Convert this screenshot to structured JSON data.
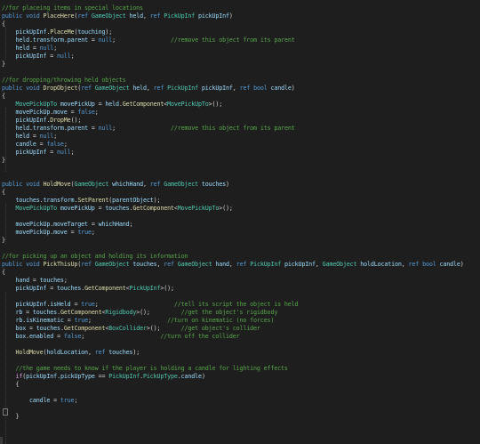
{
  "editor": {
    "lines": [
      [
        [
          "c",
          "//for placeing items in special locations"
        ]
      ],
      [
        [
          "k",
          "public "
        ],
        [
          "k",
          "void "
        ],
        [
          "f",
          "PlaceHere"
        ],
        [
          "p",
          "("
        ],
        [
          "k",
          "ref "
        ],
        [
          "t",
          "GameObject "
        ],
        [
          "v",
          "held"
        ],
        [
          "p",
          ", "
        ],
        [
          "k",
          "ref "
        ],
        [
          "t",
          "PickUpInf "
        ],
        [
          "v",
          "pickUpInf"
        ],
        [
          "p",
          ")"
        ]
      ],
      [
        [
          "p",
          "{"
        ]
      ],
      [
        [
          "p",
          "    "
        ],
        [
          "v",
          "pickUpInf"
        ],
        [
          "p",
          "."
        ],
        [
          "f",
          "PlaceMe"
        ],
        [
          "p",
          "("
        ],
        [
          "v",
          "touching"
        ],
        [
          "p",
          ");"
        ]
      ],
      [
        [
          "p",
          "    "
        ],
        [
          "v",
          "held"
        ],
        [
          "p",
          "."
        ],
        [
          "v",
          "transform"
        ],
        [
          "p",
          "."
        ],
        [
          "v",
          "parent"
        ],
        [
          "p",
          " = "
        ],
        [
          "k",
          "null"
        ],
        [
          "p",
          ";                "
        ],
        [
          "c",
          "//remove this object from its parent"
        ]
      ],
      [
        [
          "p",
          "    "
        ],
        [
          "v",
          "held"
        ],
        [
          "p",
          " = "
        ],
        [
          "k",
          "null"
        ],
        [
          "p",
          ";"
        ]
      ],
      [
        [
          "p",
          "    "
        ],
        [
          "v",
          "pickUpInf"
        ],
        [
          "p",
          " = "
        ],
        [
          "k",
          "null"
        ],
        [
          "p",
          ";"
        ]
      ],
      [
        [
          "p",
          "}"
        ]
      ],
      [],
      [
        [
          "c",
          "//for dropping/throwing held objects"
        ]
      ],
      [
        [
          "k",
          "public "
        ],
        [
          "k",
          "void "
        ],
        [
          "f",
          "DropObject"
        ],
        [
          "p",
          "("
        ],
        [
          "k",
          "ref "
        ],
        [
          "t",
          "GameObject "
        ],
        [
          "v",
          "held"
        ],
        [
          "p",
          ", "
        ],
        [
          "k",
          "ref "
        ],
        [
          "t",
          "PickUpInf "
        ],
        [
          "v",
          "pickUpInf"
        ],
        [
          "p",
          ", "
        ],
        [
          "k",
          "ref "
        ],
        [
          "k",
          "bool "
        ],
        [
          "v",
          "candle"
        ],
        [
          "p",
          ")"
        ]
      ],
      [
        [
          "p",
          "{"
        ]
      ],
      [
        [
          "p",
          "    "
        ],
        [
          "t",
          "MovePickUpTo "
        ],
        [
          "v",
          "movePickUp"
        ],
        [
          "p",
          " = "
        ],
        [
          "v",
          "held"
        ],
        [
          "p",
          "."
        ],
        [
          "f",
          "GetComponent"
        ],
        [
          "p",
          "<"
        ],
        [
          "t",
          "MovePickUpTo"
        ],
        [
          "p",
          ">();"
        ]
      ],
      [
        [
          "p",
          "    "
        ],
        [
          "v",
          "movePickUp"
        ],
        [
          "p",
          "."
        ],
        [
          "v",
          "move"
        ],
        [
          "p",
          " = "
        ],
        [
          "k",
          "false"
        ],
        [
          "p",
          ";"
        ]
      ],
      [
        [
          "p",
          "    "
        ],
        [
          "v",
          "pickUpInf"
        ],
        [
          "p",
          "."
        ],
        [
          "f",
          "DropMe"
        ],
        [
          "p",
          "();"
        ]
      ],
      [
        [
          "p",
          "    "
        ],
        [
          "v",
          "held"
        ],
        [
          "p",
          "."
        ],
        [
          "v",
          "transform"
        ],
        [
          "p",
          "."
        ],
        [
          "v",
          "parent"
        ],
        [
          "p",
          " = "
        ],
        [
          "k",
          "null"
        ],
        [
          "p",
          ";                "
        ],
        [
          "c",
          "//remove this object from its parent"
        ]
      ],
      [
        [
          "p",
          "    "
        ],
        [
          "v",
          "held"
        ],
        [
          "p",
          " = "
        ],
        [
          "k",
          "null"
        ],
        [
          "p",
          ";"
        ]
      ],
      [
        [
          "p",
          "    "
        ],
        [
          "v",
          "candle"
        ],
        [
          "p",
          " = "
        ],
        [
          "k",
          "false"
        ],
        [
          "p",
          ";"
        ]
      ],
      [
        [
          "p",
          "    "
        ],
        [
          "v",
          "pickUpInf"
        ],
        [
          "p",
          " = "
        ],
        [
          "k",
          "null"
        ],
        [
          "p",
          ";"
        ]
      ],
      [
        [
          "p",
          "}"
        ]
      ],
      [],
      [],
      [
        [
          "k",
          "public "
        ],
        [
          "k",
          "void "
        ],
        [
          "f",
          "HoldMove"
        ],
        [
          "p",
          "("
        ],
        [
          "t",
          "GameObject "
        ],
        [
          "v",
          "whichHand"
        ],
        [
          "p",
          ", "
        ],
        [
          "k",
          "ref "
        ],
        [
          "t",
          "GameObject "
        ],
        [
          "v",
          "touches"
        ],
        [
          "p",
          ")"
        ]
      ],
      [
        [
          "p",
          "{"
        ]
      ],
      [
        [
          "p",
          "    "
        ],
        [
          "v",
          "touches"
        ],
        [
          "p",
          "."
        ],
        [
          "v",
          "transform"
        ],
        [
          "p",
          "."
        ],
        [
          "f",
          "SetParent"
        ],
        [
          "p",
          "("
        ],
        [
          "v",
          "parentObject"
        ],
        [
          "p",
          ");"
        ]
      ],
      [
        [
          "p",
          "    "
        ],
        [
          "t",
          "MovePickUpTo "
        ],
        [
          "v",
          "movePickUp"
        ],
        [
          "p",
          " = "
        ],
        [
          "v",
          "touches"
        ],
        [
          "p",
          "."
        ],
        [
          "f",
          "GetComponent"
        ],
        [
          "p",
          "<"
        ],
        [
          "t",
          "MovePickUpTo"
        ],
        [
          "p",
          ">();"
        ]
      ],
      [],
      [
        [
          "p",
          "    "
        ],
        [
          "v",
          "movePickUp"
        ],
        [
          "p",
          "."
        ],
        [
          "v",
          "moveTarget"
        ],
        [
          "p",
          " = "
        ],
        [
          "v",
          "whichHand"
        ],
        [
          "p",
          ";"
        ]
      ],
      [
        [
          "p",
          "    "
        ],
        [
          "v",
          "movePickUp"
        ],
        [
          "p",
          "."
        ],
        [
          "v",
          "move"
        ],
        [
          "p",
          " = "
        ],
        [
          "k",
          "true"
        ],
        [
          "p",
          ";"
        ]
      ],
      [
        [
          "p",
          "}"
        ]
      ],
      [],
      [
        [
          "c",
          "//for picking up an object and holding its information"
        ]
      ],
      [
        [
          "k",
          "public "
        ],
        [
          "k",
          "void "
        ],
        [
          "f",
          "PickThisUp"
        ],
        [
          "p",
          "("
        ],
        [
          "k",
          "ref "
        ],
        [
          "t",
          "GameObject "
        ],
        [
          "v",
          "touches"
        ],
        [
          "p",
          ", "
        ],
        [
          "k",
          "ref "
        ],
        [
          "t",
          "GameObject "
        ],
        [
          "v",
          "hand"
        ],
        [
          "p",
          ", "
        ],
        [
          "k",
          "ref "
        ],
        [
          "t",
          "PickUpInf "
        ],
        [
          "v",
          "pickUpInf"
        ],
        [
          "p",
          ", "
        ],
        [
          "t",
          "GameObject "
        ],
        [
          "v",
          "holdLocation"
        ],
        [
          "p",
          ", "
        ],
        [
          "k",
          "ref "
        ],
        [
          "k",
          "bool "
        ],
        [
          "v",
          "candle"
        ],
        [
          "p",
          ")"
        ]
      ],
      [
        [
          "p",
          "{"
        ]
      ],
      [
        [
          "p",
          "    "
        ],
        [
          "v",
          "hand"
        ],
        [
          "p",
          " = "
        ],
        [
          "v",
          "touches"
        ],
        [
          "p",
          ";"
        ]
      ],
      [
        [
          "p",
          "    "
        ],
        [
          "v",
          "pickUpInf"
        ],
        [
          "p",
          " = "
        ],
        [
          "v",
          "touches"
        ],
        [
          "p",
          "."
        ],
        [
          "f",
          "GetComponent"
        ],
        [
          "p",
          "<"
        ],
        [
          "t",
          "PickUpInf"
        ],
        [
          "p",
          ">();"
        ]
      ],
      [],
      [
        [
          "p",
          "    "
        ],
        [
          "v",
          "pickUpInf"
        ],
        [
          "p",
          "."
        ],
        [
          "v",
          "isHeld"
        ],
        [
          "p",
          " = "
        ],
        [
          "k",
          "true"
        ],
        [
          "p",
          ";                      "
        ],
        [
          "c",
          "//tell its script the object is held"
        ]
      ],
      [
        [
          "p",
          "    "
        ],
        [
          "v",
          "rb"
        ],
        [
          "p",
          " = "
        ],
        [
          "v",
          "touches"
        ],
        [
          "p",
          "."
        ],
        [
          "f",
          "GetComponent"
        ],
        [
          "p",
          "<"
        ],
        [
          "t",
          "Rigidbody"
        ],
        [
          "p",
          ">();         "
        ],
        [
          "c",
          "//get the object's rigidbody"
        ]
      ],
      [
        [
          "p",
          "    "
        ],
        [
          "v",
          "rb"
        ],
        [
          "p",
          "."
        ],
        [
          "v",
          "isKinematic"
        ],
        [
          "p",
          " = "
        ],
        [
          "k",
          "true"
        ],
        [
          "p",
          ";                      "
        ],
        [
          "c",
          "//turn on kinematic (no forces)"
        ]
      ],
      [
        [
          "p",
          "    "
        ],
        [
          "v",
          "box"
        ],
        [
          "p",
          " = "
        ],
        [
          "v",
          "touches"
        ],
        [
          "p",
          "."
        ],
        [
          "f",
          "GetComponent"
        ],
        [
          "p",
          "<"
        ],
        [
          "t",
          "BoxCollider"
        ],
        [
          "p",
          ">();      "
        ],
        [
          "c",
          "//get object's collider"
        ]
      ],
      [
        [
          "p",
          "    "
        ],
        [
          "v",
          "box"
        ],
        [
          "p",
          "."
        ],
        [
          "v",
          "enabled"
        ],
        [
          "p",
          " = "
        ],
        [
          "k",
          "false"
        ],
        [
          "p",
          ";                      "
        ],
        [
          "c",
          "//turn off the collider"
        ]
      ],
      [],
      [
        [
          "p",
          "    "
        ],
        [
          "f",
          "HoldMove"
        ],
        [
          "p",
          "("
        ],
        [
          "v",
          "holdLocation"
        ],
        [
          "p",
          ", "
        ],
        [
          "k",
          "ref "
        ],
        [
          "v",
          "touches"
        ],
        [
          "p",
          ");"
        ]
      ],
      [],
      [
        [
          "p",
          "    "
        ],
        [
          "c",
          "//the game needs to know if the player is holding a candle for lighting effects"
        ]
      ],
      [
        [
          "p",
          "    "
        ],
        [
          "kc",
          "if"
        ],
        [
          "p",
          "("
        ],
        [
          "v",
          "pickUpInf"
        ],
        [
          "p",
          "."
        ],
        [
          "v",
          "pickUpType"
        ],
        [
          "p",
          " == "
        ],
        [
          "t",
          "PickUpInf"
        ],
        [
          "p",
          "."
        ],
        [
          "t",
          "PickUpType"
        ],
        [
          "p",
          "."
        ],
        [
          "v",
          "candle"
        ],
        [
          "p",
          ")"
        ]
      ],
      [
        [
          "p",
          "    {"
        ]
      ],
      [],
      [
        [
          "p",
          "        "
        ],
        [
          "v",
          "candle"
        ],
        [
          "p",
          " = "
        ],
        [
          "k",
          "true"
        ],
        [
          "p",
          ";"
        ]
      ],
      [],
      [
        [
          "p",
          "    }"
        ]
      ]
    ]
  }
}
